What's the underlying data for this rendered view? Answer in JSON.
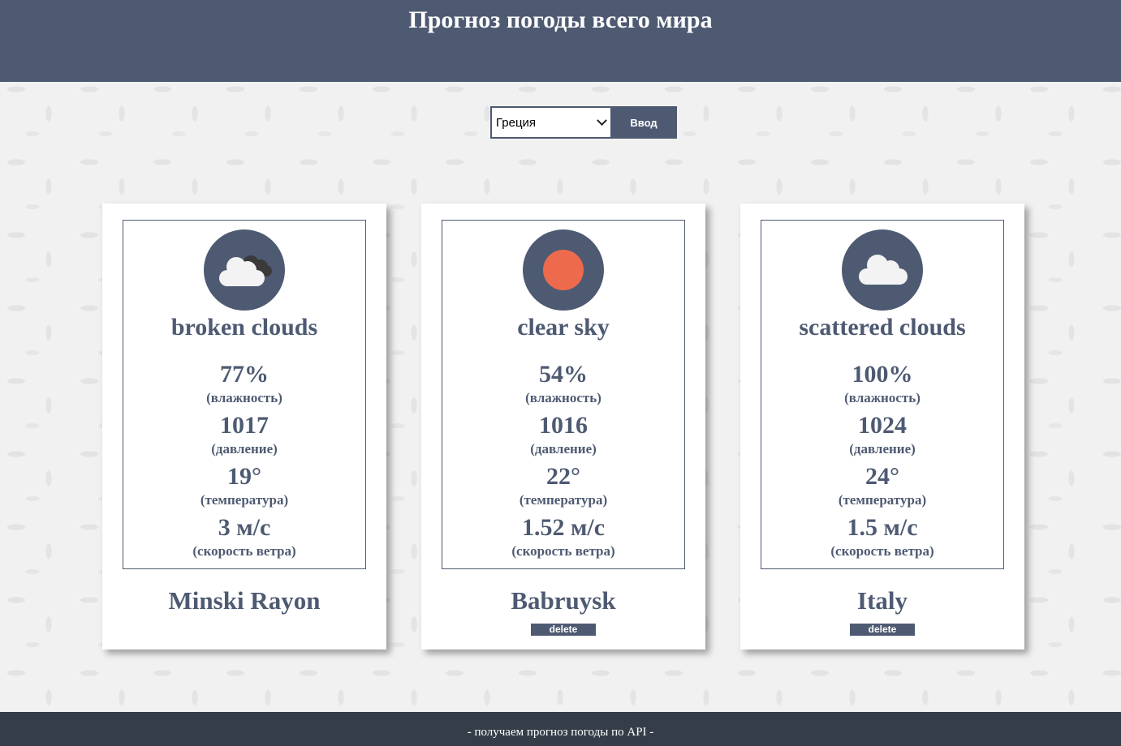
{
  "header": {
    "title": "Прогноз погоды всего мира"
  },
  "search": {
    "selected": "Греция",
    "submit_label": "Ввод"
  },
  "cards": [
    {
      "icon": "broken-clouds-icon",
      "description": "broken clouds",
      "humidity": "77%",
      "humidity_label": "(влажность)",
      "pressure": "1017",
      "pressure_label": "(давление)",
      "temperature": "19°",
      "temperature_label": "(температура)",
      "wind": "3 м/с",
      "wind_label": "(скорость ветра)",
      "city": "Minski Rayon"
    },
    {
      "icon": "clear-sky-icon",
      "description": "clear sky",
      "humidity": "54%",
      "humidity_label": "(влажность)",
      "pressure": "1016",
      "pressure_label": "(давление)",
      "temperature": "22°",
      "temperature_label": "(температура)",
      "wind": "1.52 м/с",
      "wind_label": "(скорость ветра)",
      "city": "Babruysk",
      "delete_label": "delete"
    },
    {
      "icon": "scattered-clouds-icon",
      "description": "scattered clouds",
      "humidity": "100%",
      "humidity_label": "(влажность)",
      "pressure": "1024",
      "pressure_label": "(давление)",
      "temperature": "24°",
      "temperature_label": "(температура)",
      "wind": "1.5 м/с",
      "wind_label": "(скорость ветра)",
      "city": "Italy",
      "delete_label": "delete"
    }
  ],
  "footer": {
    "text": "- получаем прогноз погоды по API -"
  },
  "colors": {
    "primary": "#4e5a72",
    "sun": "#ee6a4c",
    "footer": "#353d48"
  }
}
